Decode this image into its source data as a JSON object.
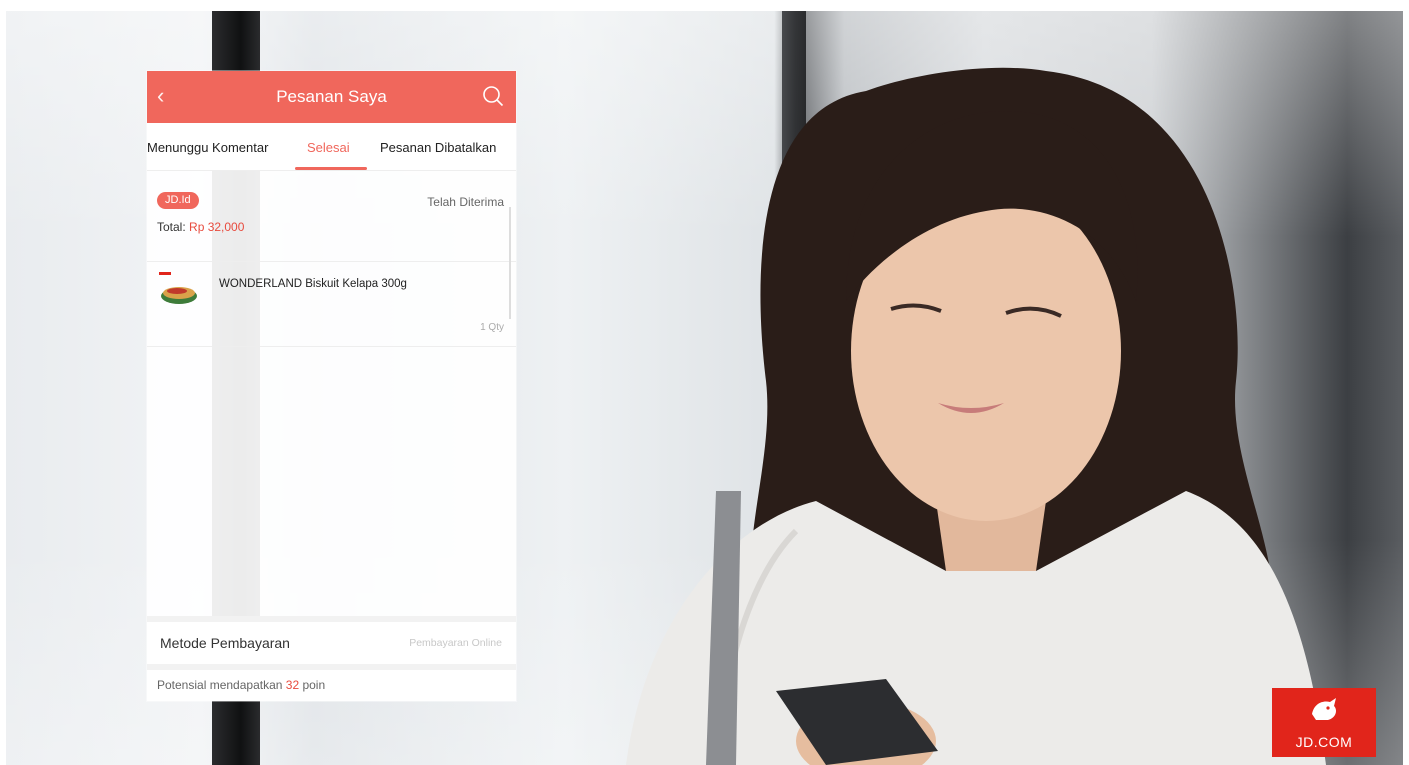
{
  "app": {
    "header": {
      "title": "Pesanan Saya",
      "back_icon": "chevron-left-icon",
      "search_icon": "search-icon"
    },
    "tabs": [
      {
        "label": "Menunggu Komentar",
        "active": false
      },
      {
        "label": "Selesai",
        "active": true
      },
      {
        "label": "Pesanan Dibatalkan",
        "active": false
      }
    ],
    "order": {
      "store_badge": "JD.Id",
      "status": "Telah Diterima",
      "total_label": "Total:",
      "total_amount": "Rp 32,000",
      "items": [
        {
          "name": "WONDERLAND Biskuit Kelapa 300g",
          "qty": "1 Qty"
        }
      ]
    },
    "payment": {
      "label": "Metode Pembayaran",
      "value": "Pembayaran Online"
    },
    "points": {
      "prefix": "Potensial mendapatkan ",
      "value": "32",
      "suffix": " poin"
    },
    "colors": {
      "accent": "#f0675c",
      "price": "#e84b3e"
    }
  },
  "brand": {
    "logo_text": "JD.COM",
    "color": "#e1251b"
  }
}
